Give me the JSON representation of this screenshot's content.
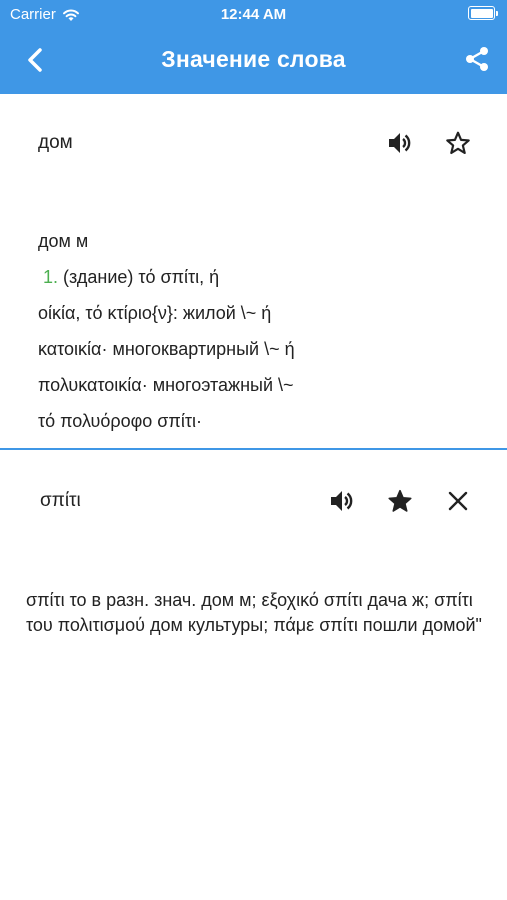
{
  "status_bar": {
    "carrier": "Carrier",
    "time": "12:44 AM"
  },
  "header": {
    "title": "Значение слова",
    "accent_color": "#3f97e6"
  },
  "entries": [
    {
      "word": "дом",
      "favorite": false,
      "definition_heading": "дом м",
      "sense_number": "1.",
      "sense_line1": " (здание) τό σπίτι, ή",
      "lines": [
        "οίκία, τό κτίριο{ν}: жилой \\~ ή",
        "κατοικία· многоквартирный \\~ ή",
        "πολυκατοικία· многоэтажный \\~",
        "τό πολυόροφο σπίτι·"
      ]
    },
    {
      "word": "σπίτι",
      "favorite": true,
      "definition": "  σπίτι το в разн. знач. дом м; εξοχικό σπίτι дача ж; σπίτι του πολιτισμού дом культуры; πάμε σπίτι пошли домой\""
    }
  ],
  "icons": {
    "back": "chevron-left-icon",
    "share": "share-icon",
    "sound": "speaker-icon",
    "star_outline": "star-outline-icon",
    "star_filled": "star-filled-icon",
    "close": "close-icon"
  }
}
